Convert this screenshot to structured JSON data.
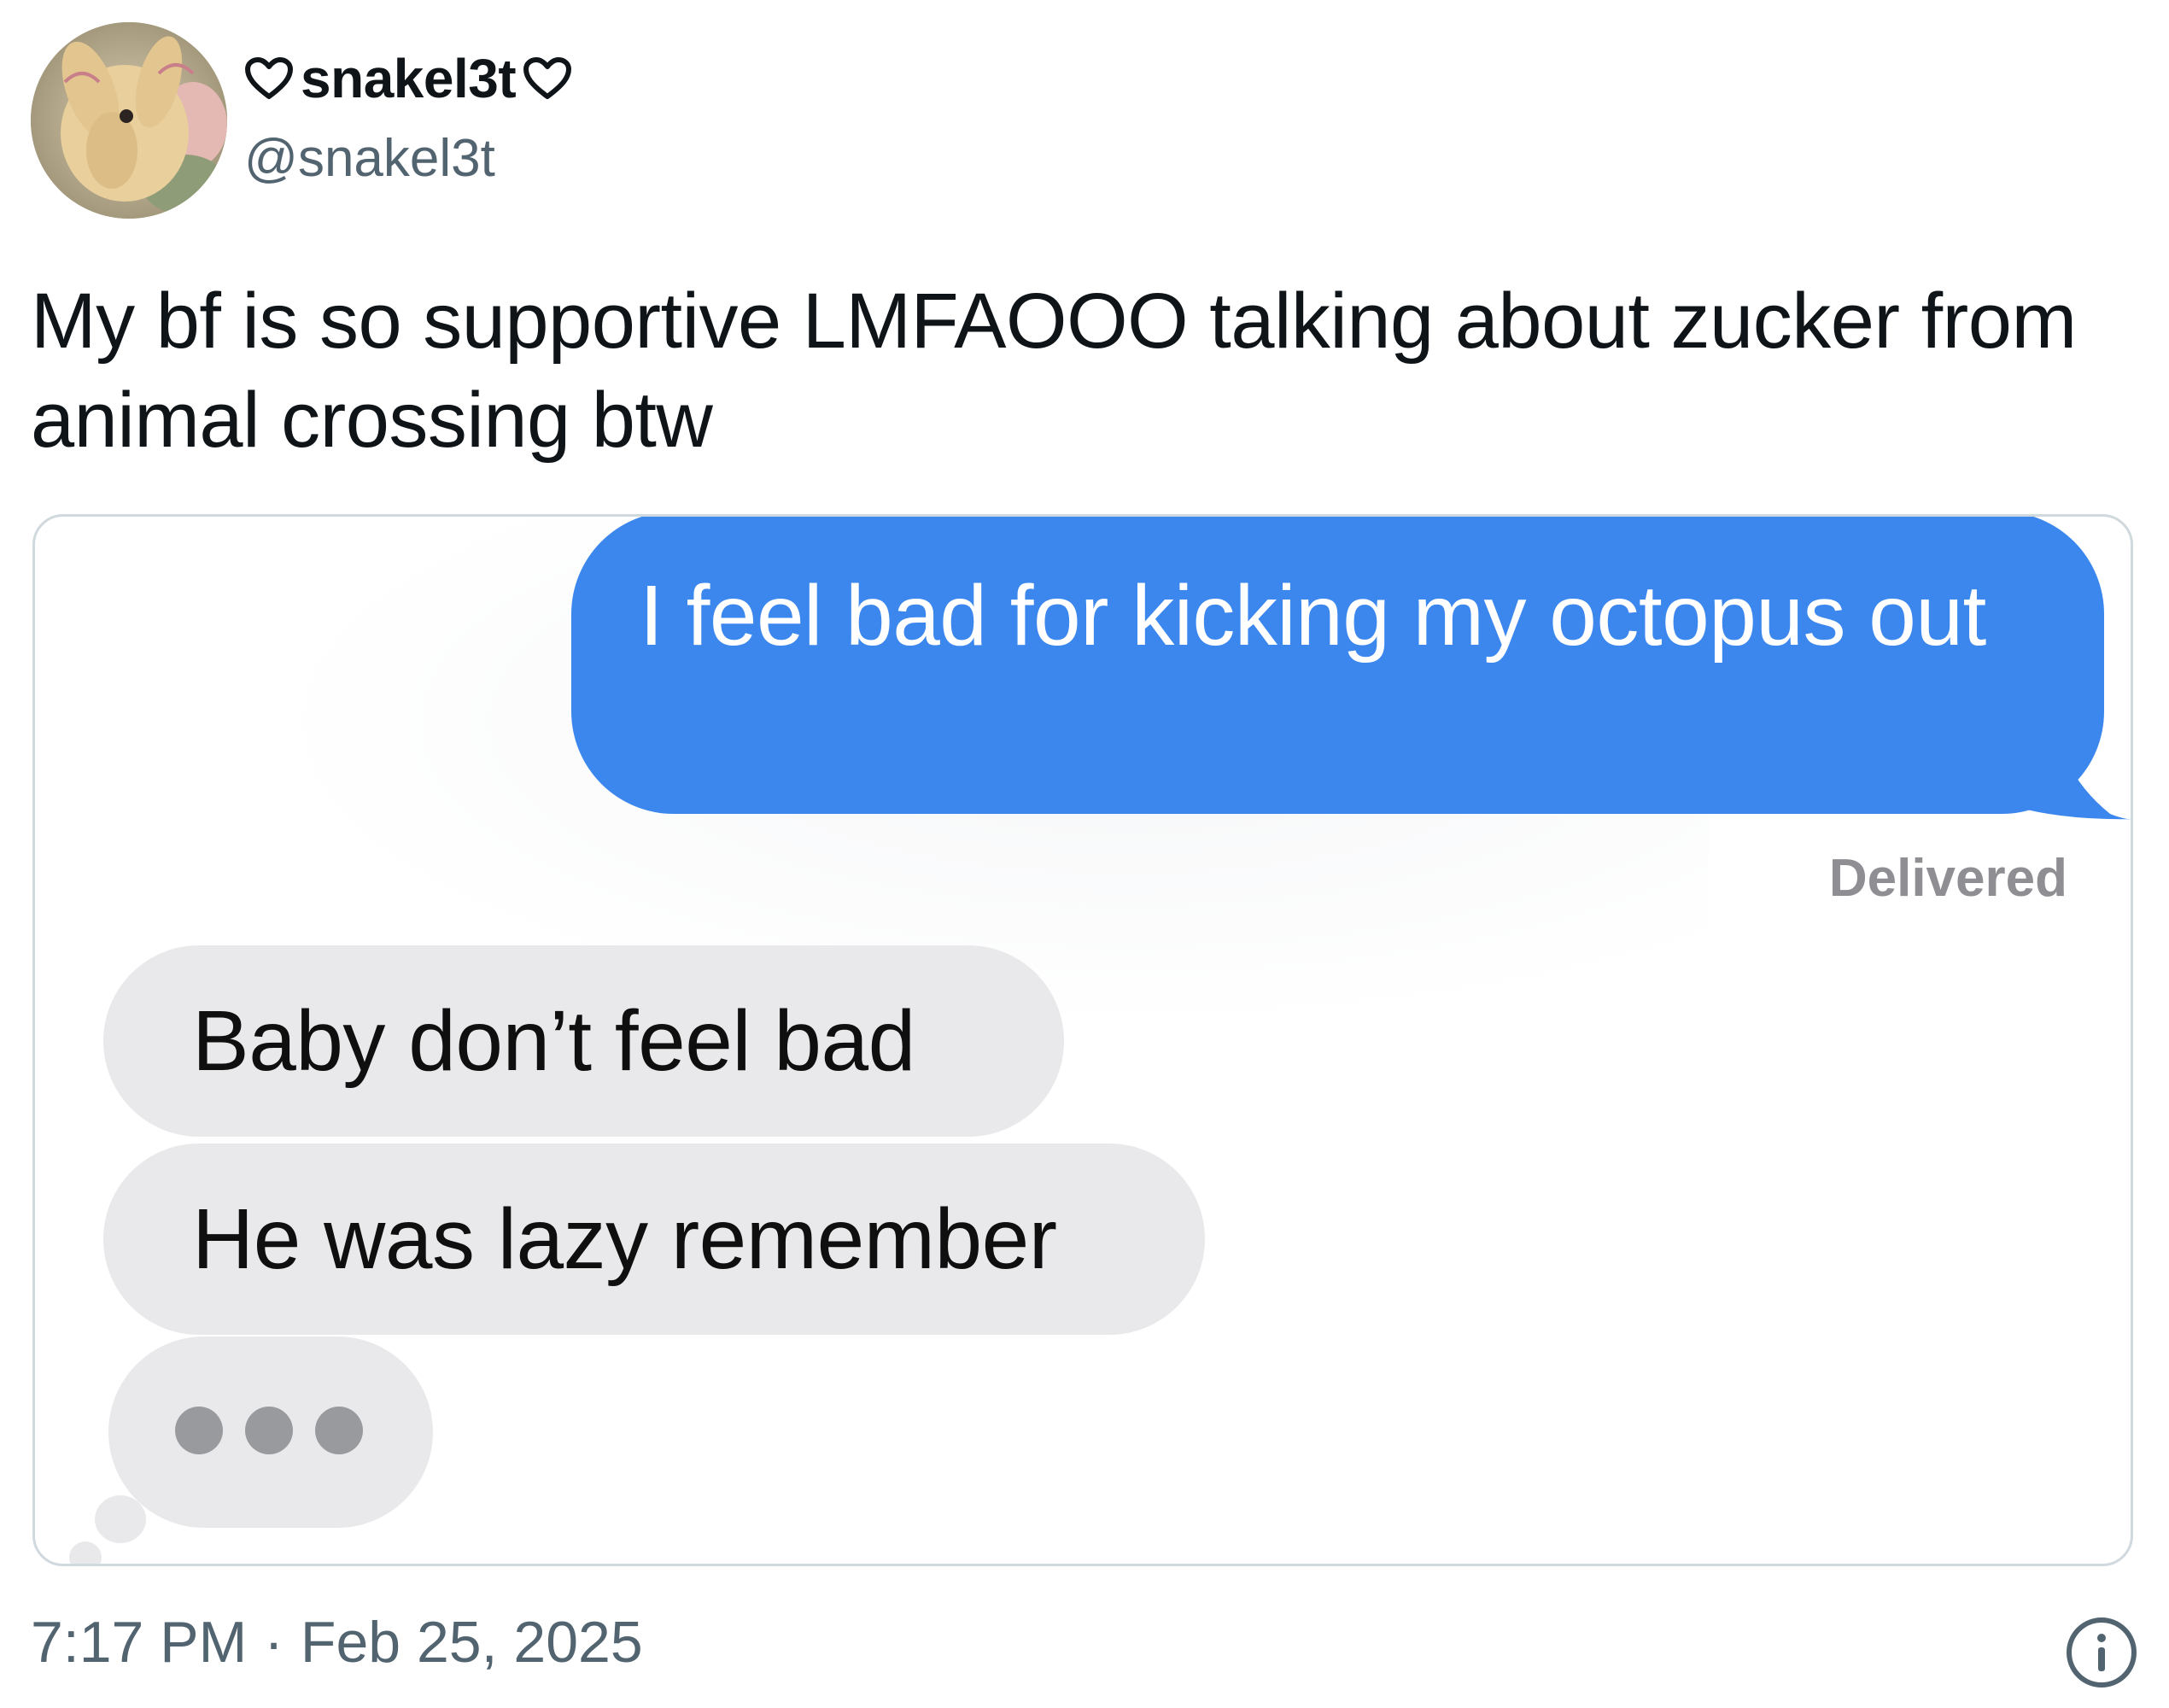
{
  "author": {
    "display_name": "snakel3t",
    "handle": "@snakel3t",
    "avatar_icon": "bunny-avatar-image",
    "name_decoration_icon": "heart-outline-icon"
  },
  "tweet": {
    "text": "My bf is so supportive LMFAOOO talking about zucker from animal crossing btw",
    "time": "7:17 PM",
    "separator": "·",
    "date": "Feb 25, 2025",
    "info_icon": "info-circle-icon"
  },
  "screenshot": {
    "sent_message": "I feel bad for kicking my octopus out",
    "delivered_label": "Delivered",
    "received_messages": [
      "Baby don’t feel bad",
      "He was lazy remember"
    ],
    "typing_indicator_icon": "typing-dots-icon",
    "colors": {
      "sent_bubble": "#3b87ee",
      "received_bubble": "#e9e9eb"
    }
  }
}
